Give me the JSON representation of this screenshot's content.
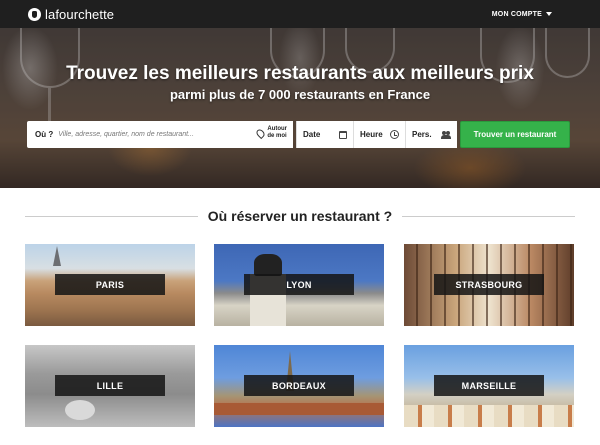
{
  "header": {
    "logo_text": "lafourchette",
    "account_label": "MON COMPTE"
  },
  "hero": {
    "title": "Trouvez les meilleurs restaurants aux meilleurs prix",
    "subtitle": "parmi plus de 7 000 restaurants en France"
  },
  "search": {
    "where_label": "Où ?",
    "where_placeholder": "Ville, adresse, quartier, nom de restaurant...",
    "near_me_line1": "Autour",
    "near_me_line2": "de moi",
    "date_label": "Date",
    "time_label": "Heure",
    "persons_label": "Pers.",
    "submit_label": "Trouver un restaurant"
  },
  "section": {
    "title": "Où réserver un restaurant ?"
  },
  "cities": [
    {
      "name": "PARIS"
    },
    {
      "name": "LYON"
    },
    {
      "name": "STRASBOURG"
    },
    {
      "name": "LILLE"
    },
    {
      "name": "BORDEAUX"
    },
    {
      "name": "MARSEILLE"
    }
  ],
  "colors": {
    "topbar": "#1f1f1f",
    "accent_green": "#35b24a",
    "tile_label_bg": "#141414"
  },
  "icons": [
    "logo-icon",
    "chevron-down-icon",
    "location-pin-icon",
    "calendar-icon",
    "clock-icon",
    "people-icon"
  ]
}
